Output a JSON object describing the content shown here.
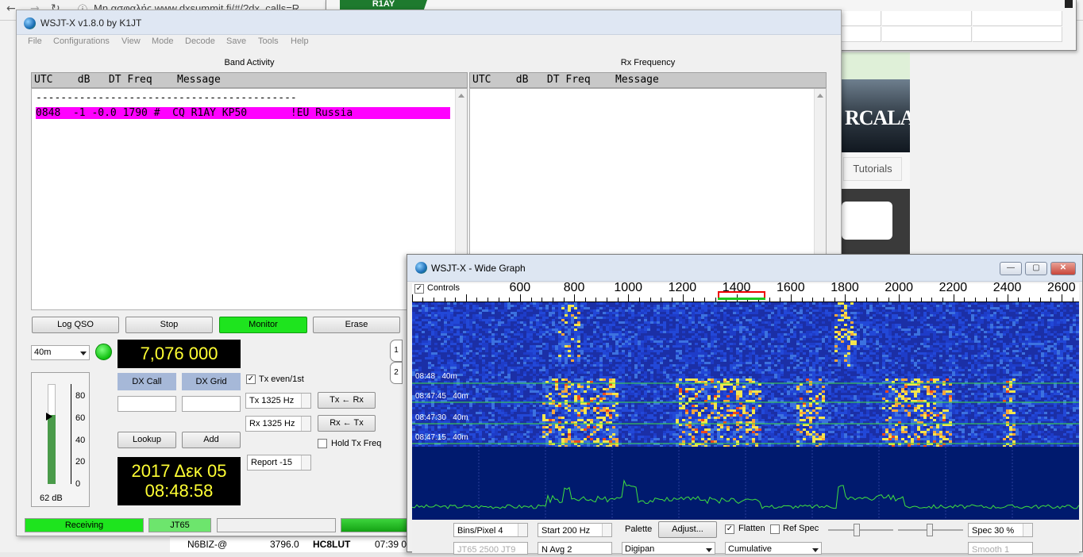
{
  "browser": {
    "url_text": "Μη ασφαλής   www.dxsummit.fi/#/?dx_calls=R",
    "tutorials_label": "Tutorials",
    "thumb_text": "RCALA",
    "spot_row": {
      "call": "N6BIZ-@",
      "freq": "3796.0",
      "dx": "HC8LUT",
      "time": "07:39 0"
    }
  },
  "table_window": {
    "highlighted_call": "R1AY"
  },
  "main": {
    "title": "WSJT-X   v1.8.0   by K1JT",
    "menu": [
      "File",
      "Configurations",
      "View",
      "Mode",
      "Decode",
      "Save",
      "Tools",
      "Help"
    ],
    "band_activity": {
      "label": "Band Activity",
      "header": "UTC    dB   DT Freq    Message",
      "separator": "------------------------------------------",
      "decodes": [
        {
          "line": "0848  -1 -0.0 1790 #  CQ R1AY KP50       !EU Russia"
        }
      ]
    },
    "rx_frequency": {
      "label": "Rx Frequency",
      "header": "UTC    dB   DT Freq    Message"
    },
    "buttons": {
      "log_qso": "Log QSO",
      "stop": "Stop",
      "monitor": "Monitor",
      "erase": "Erase",
      "lookup": "Lookup",
      "add": "Add",
      "tx_from_rx": "Tx ← Rx",
      "rx_from_tx": "Rx ← Tx"
    },
    "band_select": "40m",
    "dial_frequency": "7,076 000",
    "dx_call_label": "DX Call",
    "dx_grid_label": "DX Grid",
    "tx_even_label": "Tx even/1st",
    "tx_freq": "Tx  1325  Hz",
    "rx_freq": "Rx  1325  Hz",
    "hold_tx_label": "Hold Tx Freq",
    "report": "Report -15",
    "date": "2017 Δεκ 05",
    "time": "08:48:58",
    "meter": {
      "ticks": [
        "80",
        "60",
        "40",
        "20",
        "0"
      ],
      "level_db": "62 dB",
      "level_fraction": 0.62
    },
    "tabs": [
      "1",
      "2"
    ],
    "status": {
      "receiving": "Receiving",
      "mode": "JT65"
    }
  },
  "wide_graph": {
    "title": "WSJT-X - Wide Graph",
    "controls_label": "Controls",
    "freq_ticks": [
      "600",
      "800",
      "1000",
      "1200",
      "1400",
      "1600",
      "1800",
      "2000",
      "2200",
      "2400",
      "2600"
    ],
    "time_labels": [
      {
        "time": "08:48",
        "band": "40m"
      },
      {
        "time": "08:47:45",
        "band": "40m"
      },
      {
        "time": "08:47:30",
        "band": "40m"
      },
      {
        "time": "08:47:15",
        "band": "40m"
      }
    ],
    "controls": {
      "bins_per_pixel": "Bins/Pixel  4",
      "start": "Start 200 Hz",
      "palette_label": "Palette",
      "adjust": "Adjust...",
      "flatten": "Flatten",
      "ref_spec": "Ref Spec",
      "spec": "Spec 30 %",
      "jt65_row": "JT65  2500  JT9",
      "navg": "N Avg  2",
      "palette_value": "Digipan",
      "cumulative": "Cumulative",
      "smooth": "Smooth  1"
    }
  }
}
